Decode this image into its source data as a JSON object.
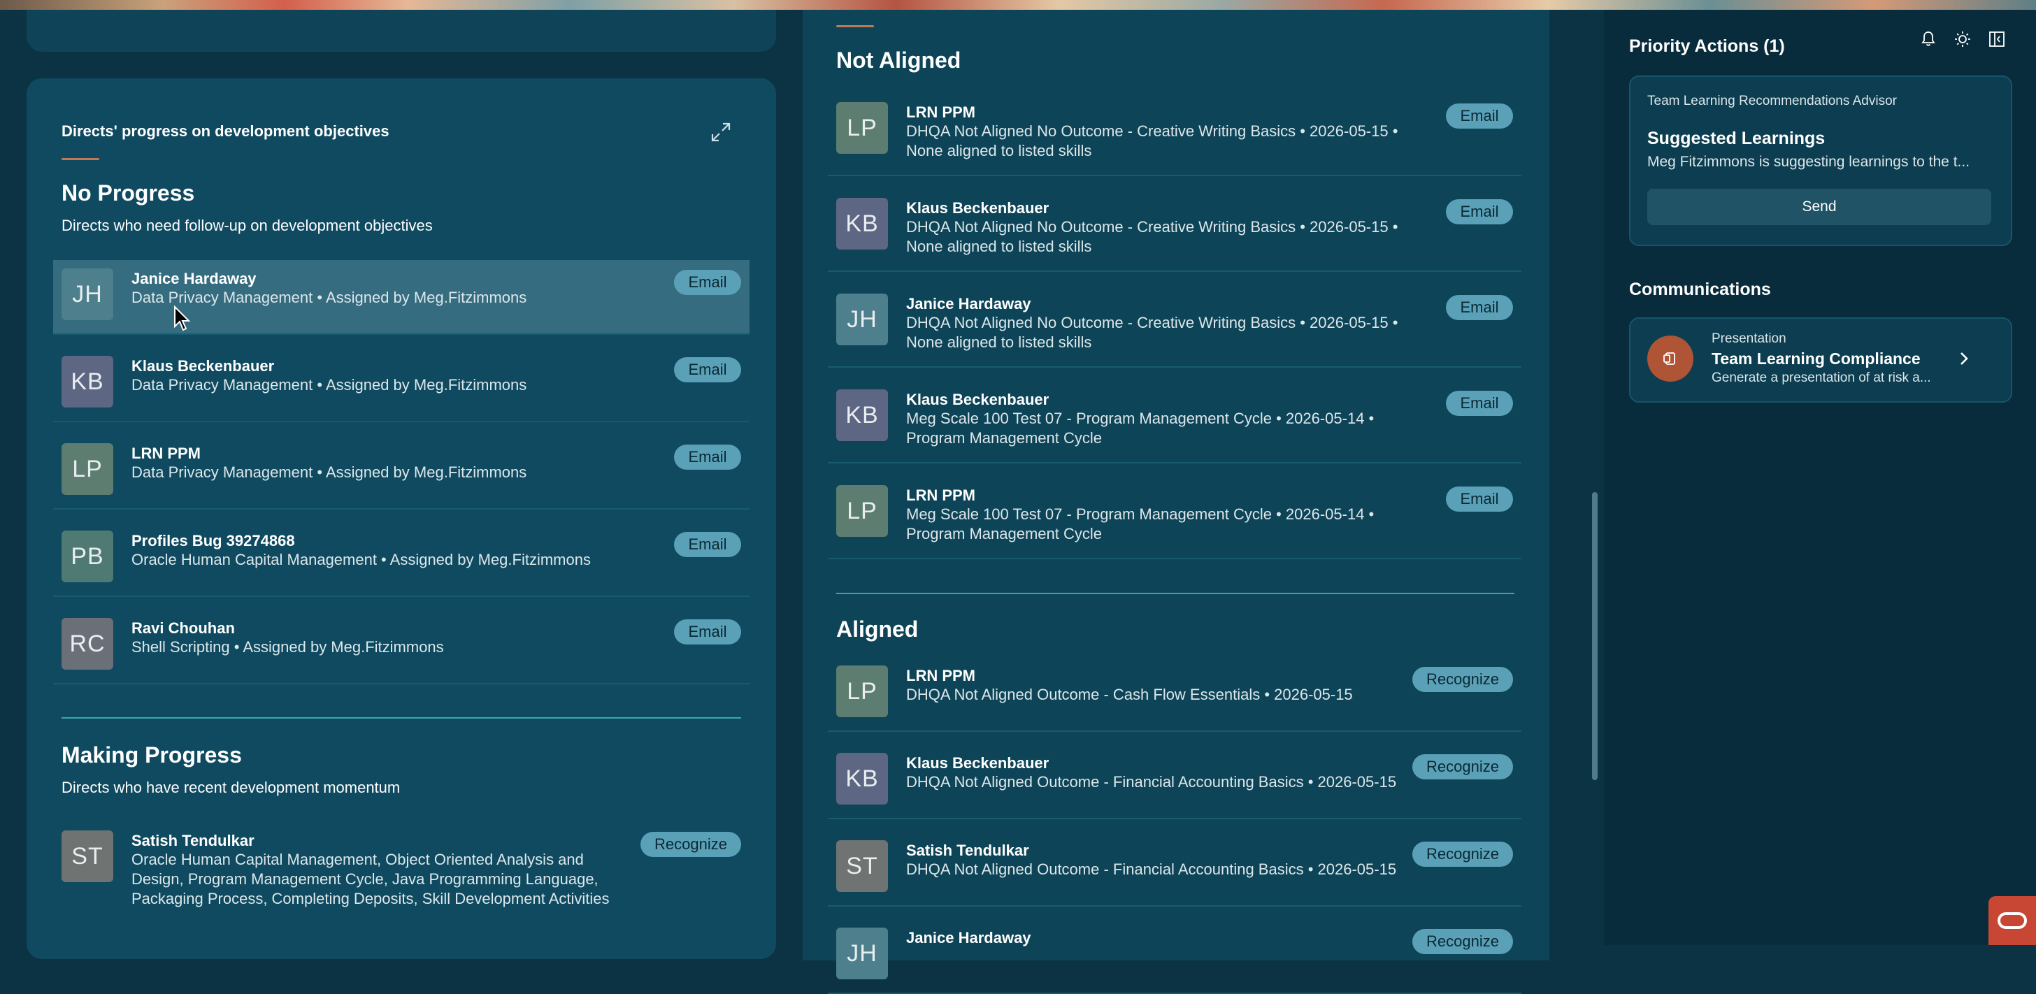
{
  "left_card": {
    "header": "Directs' progress on development objectives",
    "no_progress": {
      "title": "No Progress",
      "subtitle": "Directs who need follow-up on development objectives",
      "rows": [
        {
          "initials": "JH",
          "name": "Janice Hardaway",
          "desc": "Data Privacy Management • Assigned by Meg.Fitzimmons",
          "action": "Email",
          "avatar_color": "#4d7f8c"
        },
        {
          "initials": "KB",
          "name": "Klaus Beckenbauer",
          "desc": "Data Privacy Management • Assigned by Meg.Fitzimmons",
          "action": "Email",
          "avatar_color": "#5d6682"
        },
        {
          "initials": "LP",
          "name": "LRN PPM",
          "desc": "Data Privacy Management • Assigned by Meg.Fitzimmons",
          "action": "Email",
          "avatar_color": "#5c7d70"
        },
        {
          "initials": "PB",
          "name": "Profiles Bug 39274868",
          "desc": "Oracle Human Capital Management • Assigned by Meg.Fitzimmons",
          "action": "Email",
          "avatar_color": "#4f7a73"
        },
        {
          "initials": "RC",
          "name": "Ravi Chouhan",
          "desc": "Shell Scripting • Assigned by Meg.Fitzimmons",
          "action": "Email",
          "avatar_color": "#6b7078"
        }
      ]
    },
    "making_progress": {
      "title": "Making Progress",
      "subtitle": "Directs who have recent development momentum",
      "rows": [
        {
          "initials": "ST",
          "name": "Satish Tendulkar",
          "desc": "Oracle Human Capital Management, Object Oriented Analysis and Design, Program Management Cycle, Java Programming Language, Packaging Process, Completing Deposits, Skill Development Activities",
          "action": "Recognize",
          "avatar_color": "#6f7472"
        }
      ]
    }
  },
  "mid_card": {
    "not_aligned": {
      "title": "Not Aligned",
      "rows": [
        {
          "initials": "LP",
          "name": "LRN PPM",
          "desc": "DHQA Not Aligned No Outcome - Creative Writing Basics • 2026-05-15 • None aligned to listed skills",
          "action": "Email",
          "avatar_color": "#5c7d70"
        },
        {
          "initials": "KB",
          "name": "Klaus Beckenbauer",
          "desc": "DHQA Not Aligned No Outcome - Creative Writing Basics • 2026-05-15 • None aligned to listed skills",
          "action": "Email",
          "avatar_color": "#5d6682"
        },
        {
          "initials": "JH",
          "name": "Janice Hardaway",
          "desc": "DHQA Not Aligned No Outcome - Creative Writing Basics • 2026-05-15 • None aligned to listed skills",
          "action": "Email",
          "avatar_color": "#4d7f8c"
        },
        {
          "initials": "KB",
          "name": "Klaus Beckenbauer",
          "desc": "Meg Scale 100 Test 07 - Program Management Cycle • 2026-05-14 • Program Management Cycle",
          "action": "Email",
          "avatar_color": "#5d6682"
        },
        {
          "initials": "LP",
          "name": "LRN PPM",
          "desc": "Meg Scale 100 Test 07 - Program Management Cycle • 2026-05-14 • Program Management Cycle",
          "action": "Email",
          "avatar_color": "#5c7d70"
        }
      ]
    },
    "aligned": {
      "title": "Aligned",
      "rows": [
        {
          "initials": "LP",
          "name": "LRN PPM",
          "desc": "DHQA Not Aligned Outcome - Cash Flow Essentials • 2026-05-15",
          "action": "Recognize",
          "avatar_color": "#5c7d70"
        },
        {
          "initials": "KB",
          "name": "Klaus Beckenbauer",
          "desc": "DHQA Not Aligned Outcome - Financial Accounting Basics • 2026-05-15",
          "action": "Recognize",
          "avatar_color": "#5d6682"
        },
        {
          "initials": "ST",
          "name": "Satish Tendulkar",
          "desc": "DHQA Not Aligned Outcome - Financial Accounting Basics • 2026-05-15",
          "action": "Recognize",
          "avatar_color": "#6f7472"
        },
        {
          "initials": "JH",
          "name": "Janice Hardaway",
          "desc": "",
          "action": "Recognize",
          "avatar_color": "#4d7f8c"
        }
      ]
    }
  },
  "right_panel": {
    "priority_title": "Priority Actions (1)",
    "advisor": {
      "label": "Team Learning Recommendations Advisor",
      "title": "Suggested Learnings",
      "text": "Meg Fitzimmons is suggesting learnings to the t...",
      "button": "Send"
    },
    "communications_title": "Communications",
    "comm_item": {
      "type": "Presentation",
      "title": "Team Learning Compliance",
      "text": "Generate a presentation of at risk a..."
    },
    "icons": [
      "bell-icon",
      "sun-icon",
      "collapse-panel-icon"
    ]
  },
  "colors": {
    "background": "#0b3344",
    "card": "#0f4a60",
    "pill": "#5aa1b8",
    "accent": "#c07a57",
    "teal_divider": "#3aa7a7",
    "oracle_red": "#c74634"
  }
}
